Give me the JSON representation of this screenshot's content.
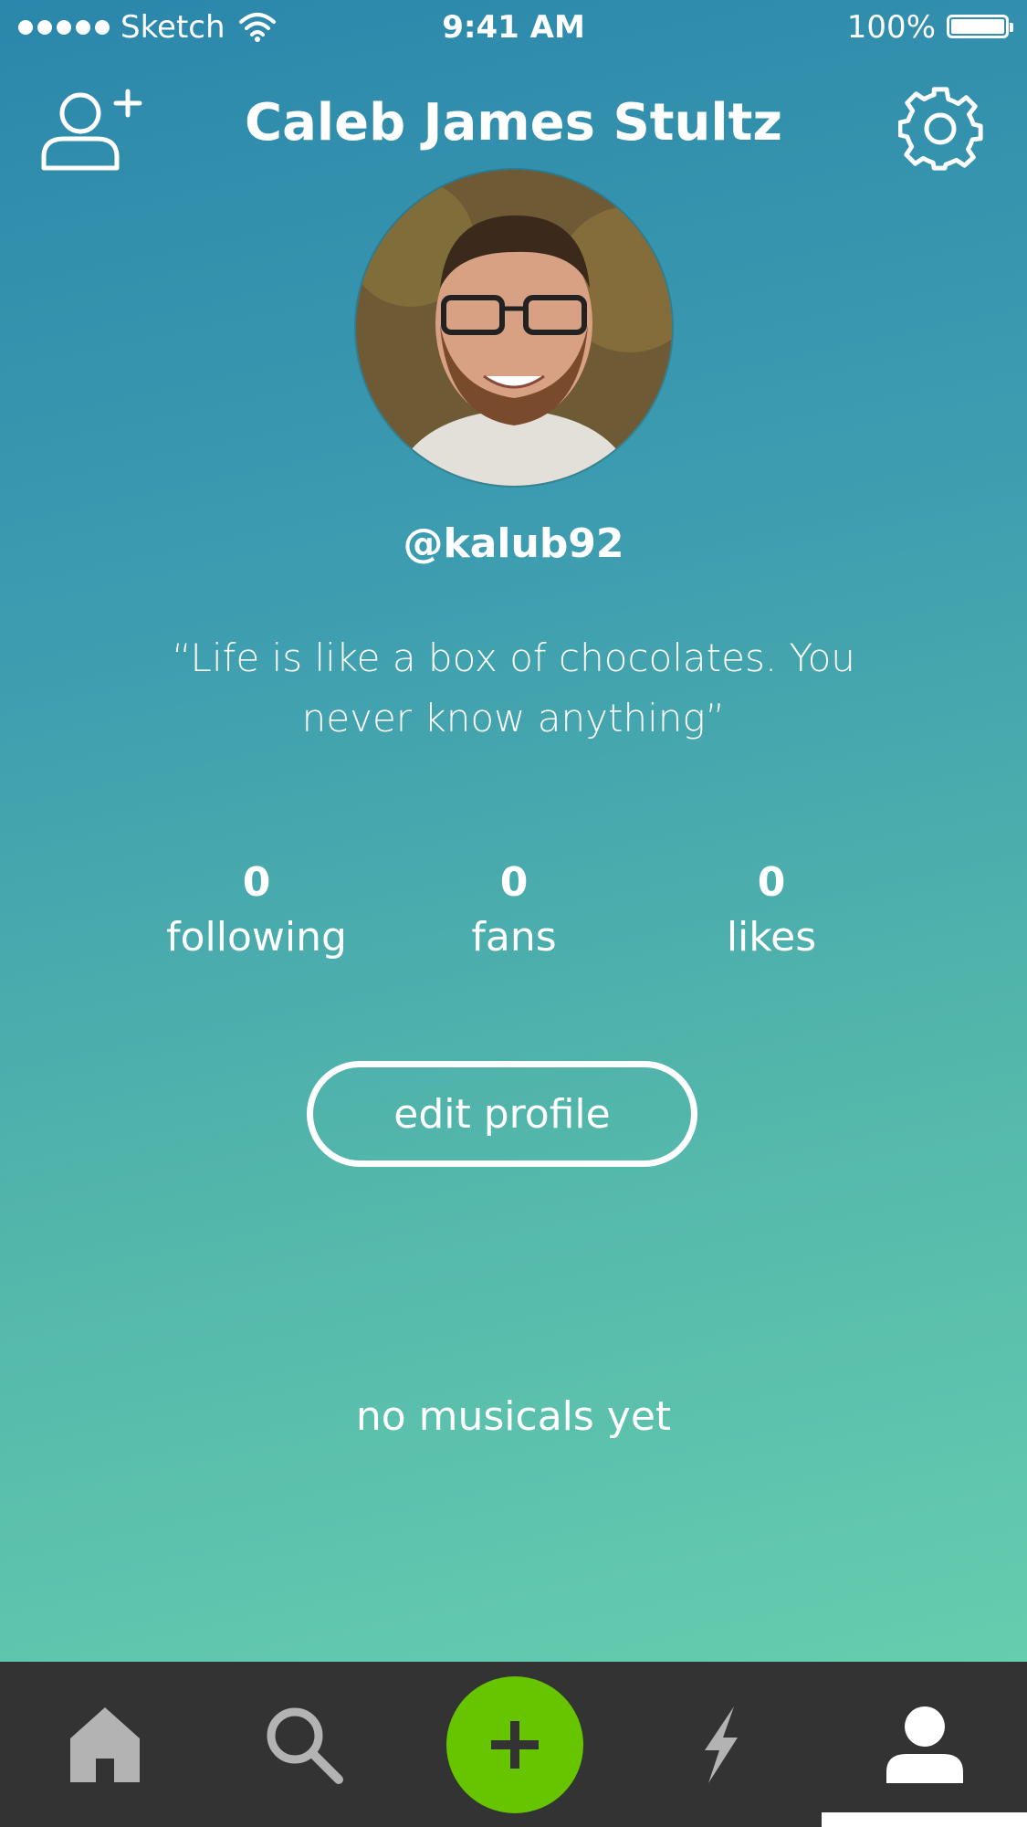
{
  "status_bar": {
    "carrier": "Sketch",
    "time": "9:41 AM",
    "battery": "100%"
  },
  "header": {
    "title": "Caleb James Stultz",
    "left_icon": "add-user-icon",
    "right_icon": "gear-icon"
  },
  "profile": {
    "avatar": "profile photo",
    "handle": "@kalub92",
    "bio": "“Life is like a box of chocolates. You never know anything”"
  },
  "stats": [
    {
      "value": "0",
      "label": "following"
    },
    {
      "value": "0",
      "label": "fans"
    },
    {
      "value": "0",
      "label": "likes"
    }
  ],
  "edit_button_label": "edit profile",
  "empty_state": "no musicals yet",
  "tab_bar": {
    "items": [
      "home-icon",
      "search-icon",
      "plus-icon",
      "lightning-icon",
      "profile-icon"
    ],
    "active": "profile-icon",
    "colors": {
      "background": "#333333",
      "fab": "#67c500",
      "inactive": "#b3b3b3",
      "active": "#ffffff"
    }
  }
}
